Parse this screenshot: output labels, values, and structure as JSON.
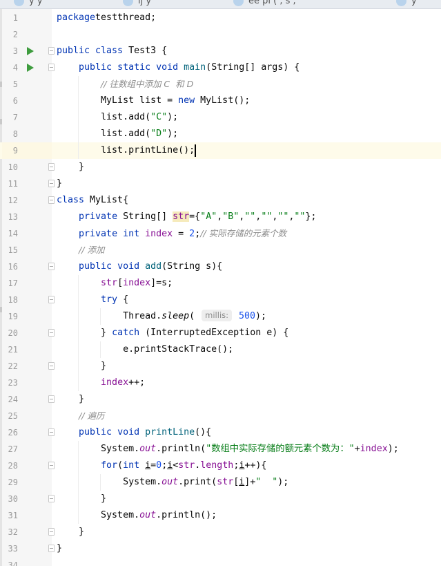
{
  "tabs": [
    {
      "label": "y        y"
    },
    {
      "label": "ij    y   "
    },
    {
      "label": "ee  pi  ( ,  s ,"
    },
    {
      "label": "  y "
    }
  ],
  "editor": {
    "lines": [
      {
        "n": "1",
        "parts": [
          [
            "kw",
            "package"
          ],
          [
            "",
            "testthread;"
          ]
        ]
      },
      {
        "n": "2",
        "parts": []
      },
      {
        "n": "3",
        "run": true,
        "fold": true,
        "parts": [
          [
            "kw",
            "public class"
          ],
          [
            "",
            " Test3 {"
          ]
        ]
      },
      {
        "n": "4",
        "run": true,
        "fold": true,
        "parts": [
          [
            "",
            "    "
          ],
          [
            "kw",
            "public static void"
          ],
          [
            "",
            " "
          ],
          [
            "mth",
            "main"
          ],
          [
            "",
            "(String[] args) {"
          ]
        ]
      },
      {
        "n": "5",
        "parts": [
          [
            "",
            "        "
          ],
          [
            "cmt",
            "// 往数组中添加 C  和 D"
          ]
        ]
      },
      {
        "n": "6",
        "parts": [
          [
            "",
            "        MyList list = "
          ],
          [
            "kw",
            "new"
          ],
          [
            "",
            " MyList();"
          ]
        ]
      },
      {
        "n": "7",
        "parts": [
          [
            "",
            "        list.add("
          ],
          [
            "str",
            "\"C\""
          ],
          [
            "",
            ");"
          ]
        ]
      },
      {
        "n": "8",
        "parts": [
          [
            "",
            "        list.add("
          ],
          [
            "str",
            "\"D\""
          ],
          [
            "",
            ");"
          ]
        ]
      },
      {
        "n": "9",
        "current": true,
        "parts": [
          [
            "",
            "        list.printLine();"
          ]
        ]
      },
      {
        "n": "10",
        "fold": true,
        "parts": [
          [
            "",
            "    }"
          ]
        ]
      },
      {
        "n": "11",
        "fold": true,
        "parts": [
          [
            "",
            "}"
          ]
        ]
      },
      {
        "n": "12",
        "fold": true,
        "parts": [
          [
            "kw",
            "class"
          ],
          [
            "",
            " MyList{"
          ]
        ]
      },
      {
        "n": "13",
        "parts": [
          [
            "",
            "    "
          ],
          [
            "kw",
            "private"
          ],
          [
            "",
            " String[] "
          ],
          [
            "fld hl",
            "str"
          ],
          [
            "",
            "={"
          ],
          [
            "str",
            "\"A\""
          ],
          [
            "",
            ","
          ],
          [
            "str",
            "\"B\""
          ],
          [
            "",
            ","
          ],
          [
            "str",
            "\"\""
          ],
          [
            "",
            ","
          ],
          [
            "str",
            "\"\""
          ],
          [
            "",
            ","
          ],
          [
            "str",
            "\"\""
          ],
          [
            "",
            ","
          ],
          [
            "str",
            "\"\""
          ],
          [
            "",
            "};"
          ]
        ]
      },
      {
        "n": "14",
        "parts": [
          [
            "",
            "    "
          ],
          [
            "kw",
            "private int"
          ],
          [
            "",
            " "
          ],
          [
            "fld",
            "index"
          ],
          [
            "",
            " = "
          ],
          [
            "num",
            "2"
          ],
          [
            "",
            ";"
          ],
          [
            "cmt",
            "// 实际存储的元素个数"
          ]
        ]
      },
      {
        "n": "15",
        "parts": [
          [
            "",
            "    "
          ],
          [
            "cmt",
            "// 添加"
          ]
        ]
      },
      {
        "n": "16",
        "fold": true,
        "parts": [
          [
            "",
            "    "
          ],
          [
            "kw",
            "public void"
          ],
          [
            "",
            " "
          ],
          [
            "mth",
            "add"
          ],
          [
            "",
            "(String s){"
          ]
        ]
      },
      {
        "n": "17",
        "parts": [
          [
            "",
            "        "
          ],
          [
            "fld",
            "str"
          ],
          [
            "",
            "["
          ],
          [
            "fld",
            "index"
          ],
          [
            "",
            "]=s;"
          ]
        ]
      },
      {
        "n": "18",
        "fold": true,
        "parts": [
          [
            "",
            "        "
          ],
          [
            "kw",
            "try"
          ],
          [
            "",
            " {"
          ]
        ]
      },
      {
        "n": "19",
        "parts": [
          [
            "",
            "            Thread."
          ],
          [
            "itl",
            "sleep"
          ],
          [
            "",
            "( "
          ],
          [
            "hint",
            "millis:"
          ],
          [
            "num",
            " 500"
          ],
          [
            "",
            ");"
          ]
        ]
      },
      {
        "n": "20",
        "fold": true,
        "parts": [
          [
            "",
            "        } "
          ],
          [
            "kw",
            "catch"
          ],
          [
            "",
            " (InterruptedException e) {"
          ]
        ]
      },
      {
        "n": "21",
        "parts": [
          [
            "",
            "            e.printStackTrace();"
          ]
        ]
      },
      {
        "n": "22",
        "fold": true,
        "parts": [
          [
            "",
            "        }"
          ]
        ]
      },
      {
        "n": "23",
        "parts": [
          [
            "",
            "        "
          ],
          [
            "fld",
            "index"
          ],
          [
            "",
            "++;"
          ]
        ]
      },
      {
        "n": "24",
        "fold": true,
        "parts": [
          [
            "",
            "    }"
          ]
        ]
      },
      {
        "n": "25",
        "parts": [
          [
            "",
            "    "
          ],
          [
            "cmt",
            "// 遍历"
          ]
        ]
      },
      {
        "n": "26",
        "fold": true,
        "parts": [
          [
            "",
            "    "
          ],
          [
            "kw",
            "public void"
          ],
          [
            "",
            " "
          ],
          [
            "mth",
            "printLine"
          ],
          [
            "",
            "(){"
          ]
        ]
      },
      {
        "n": "27",
        "parts": [
          [
            "",
            "        System."
          ],
          [
            "stat",
            "out"
          ],
          [
            "",
            ".println("
          ],
          [
            "str",
            "\"数组中实际存储的额元素个数为：\""
          ],
          [
            "",
            "+"
          ],
          [
            "fld",
            "index"
          ],
          [
            "",
            ");"
          ]
        ]
      },
      {
        "n": "28",
        "fold": true,
        "parts": [
          [
            "",
            "        "
          ],
          [
            "kw",
            "for"
          ],
          [
            "",
            "("
          ],
          [
            "kw",
            "int"
          ],
          [
            "",
            " "
          ],
          [
            "ul",
            "i"
          ],
          [
            "",
            "="
          ],
          [
            "num",
            "0"
          ],
          [
            "",
            ";"
          ],
          [
            "ul",
            "i"
          ],
          [
            "",
            "<"
          ],
          [
            "fld",
            "str"
          ],
          [
            "",
            "."
          ],
          [
            "fld",
            "length"
          ],
          [
            "",
            ";"
          ],
          [
            "ul",
            "i"
          ],
          [
            "",
            "++){"
          ]
        ]
      },
      {
        "n": "29",
        "parts": [
          [
            "",
            "            System."
          ],
          [
            "stat",
            "out"
          ],
          [
            "",
            ".print("
          ],
          [
            "fld",
            "str"
          ],
          [
            "",
            "["
          ],
          [
            "ul",
            "i"
          ],
          [
            "",
            "]+"
          ],
          [
            "str",
            "\"  \""
          ],
          [
            "",
            ");"
          ]
        ]
      },
      {
        "n": "30",
        "fold": true,
        "parts": [
          [
            "",
            "        }"
          ]
        ]
      },
      {
        "n": "31",
        "parts": [
          [
            "",
            "        System."
          ],
          [
            "stat",
            "out"
          ],
          [
            "",
            ".println();"
          ]
        ]
      },
      {
        "n": "32",
        "fold": true,
        "parts": [
          [
            "",
            "    }"
          ]
        ]
      },
      {
        "n": "33",
        "fold": true,
        "parts": [
          [
            "",
            "}"
          ]
        ]
      },
      {
        "n": "34",
        "parts": []
      }
    ]
  },
  "colors": {
    "keyword": "#0033b3",
    "string": "#067d17",
    "number": "#1750eb",
    "comment": "#8c8c8c",
    "field": "#871094",
    "method": "#00627a",
    "run_icon": "#3e9c3e",
    "current_line": "#fefbea"
  },
  "icons": {
    "run": "run-icon",
    "fold": "fold-icon",
    "tab": "java-file-icon"
  }
}
